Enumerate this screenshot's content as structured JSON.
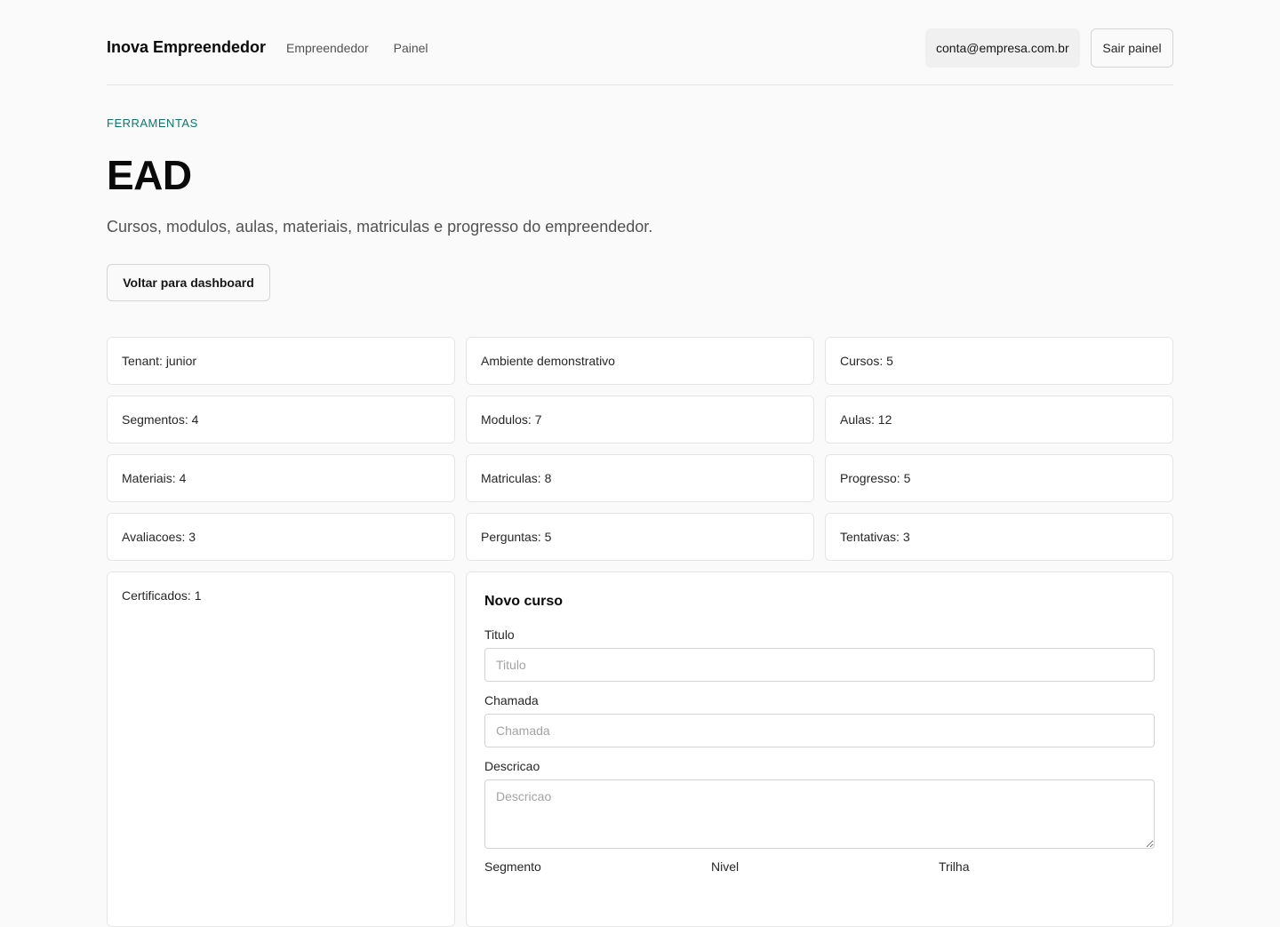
{
  "header": {
    "brand": "Inova Empreendedor",
    "nav": [
      "Empreendedor",
      "Painel"
    ],
    "account": "conta@empresa.com.br",
    "logout": "Sair painel"
  },
  "page": {
    "eyebrow": "FERRAMENTAS",
    "title": "EAD",
    "subtitle": "Cursos, modulos, aulas, materiais, matriculas e progresso do empreendedor.",
    "back": "Voltar para dashboard"
  },
  "stats": [
    "Tenant: junior",
    "Ambiente demonstrativo",
    "Cursos: 5",
    "Segmentos: 4",
    "Modulos: 7",
    "Aulas: 12",
    "Materiais: 4",
    "Matriculas: 8",
    "Progresso: 5",
    "Avaliacoes: 3",
    "Perguntas: 5",
    "Tentativas: 3"
  ],
  "certificates": "Certificados: 1",
  "form": {
    "heading": "Novo curso",
    "titulo_label": "Titulo",
    "titulo_placeholder": "Titulo",
    "chamada_label": "Chamada",
    "chamada_placeholder": "Chamada",
    "descricao_label": "Descricao",
    "descricao_placeholder": "Descricao",
    "segmento_label": "Segmento",
    "nivel_label": "Nivel",
    "trilha_label": "Trilha"
  }
}
